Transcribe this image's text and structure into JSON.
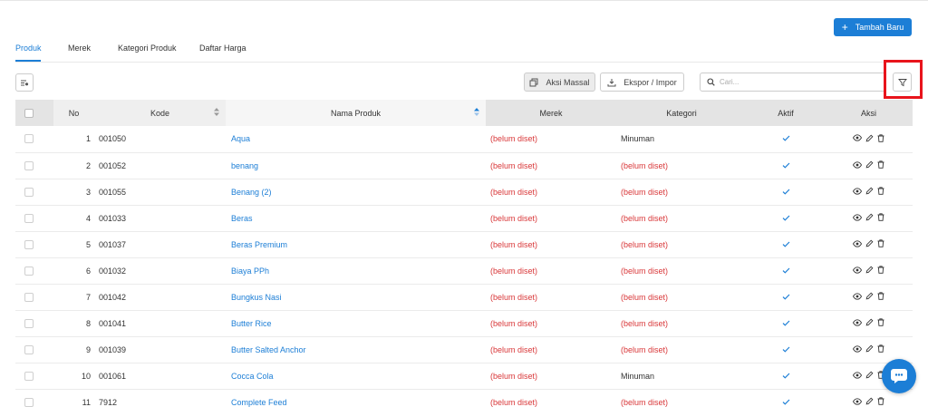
{
  "header": {
    "add_button_label": "Tambah Baru"
  },
  "tabs": [
    {
      "label": "Produk",
      "active": true
    },
    {
      "label": "Merek",
      "active": false
    },
    {
      "label": "Kategori Produk",
      "active": false
    },
    {
      "label": "Daftar Harga",
      "active": false
    }
  ],
  "toolbar": {
    "mass_action_label": "Aksi Massal",
    "export_import_label": "Ekspor / Impor",
    "search_placeholder": "Cari..."
  },
  "table": {
    "columns": [
      "No",
      "Kode",
      "Nama Produk",
      "Merek",
      "Kategori",
      "Aktif",
      "Aksi"
    ],
    "rows": [
      {
        "no": "1",
        "code": "001050",
        "name": "Aqua",
        "brand": "(belum diset)",
        "category": "Minuman"
      },
      {
        "no": "2",
        "code": "001052",
        "name": "benang",
        "brand": "(belum diset)",
        "category": "(belum diset)"
      },
      {
        "no": "3",
        "code": "001055",
        "name": "Benang (2)",
        "brand": "(belum diset)",
        "category": "(belum diset)"
      },
      {
        "no": "4",
        "code": "001033",
        "name": "Beras",
        "brand": "(belum diset)",
        "category": "(belum diset)"
      },
      {
        "no": "5",
        "code": "001037",
        "name": "Beras Premium",
        "brand": "(belum diset)",
        "category": "(belum diset)"
      },
      {
        "no": "6",
        "code": "001032",
        "name": "Biaya PPh",
        "brand": "(belum diset)",
        "category": "(belum diset)"
      },
      {
        "no": "7",
        "code": "001042",
        "name": "Bungkus Nasi",
        "brand": "(belum diset)",
        "category": "(belum diset)"
      },
      {
        "no": "8",
        "code": "001041",
        "name": "Butter Rice",
        "brand": "(belum diset)",
        "category": "(belum diset)"
      },
      {
        "no": "9",
        "code": "001039",
        "name": "Butter Salted Anchor",
        "brand": "(belum diset)",
        "category": "(belum diset)"
      },
      {
        "no": "10",
        "code": "001061",
        "name": "Cocca Cola",
        "brand": "(belum diset)",
        "category": "Minuman"
      },
      {
        "no": "11",
        "code": "7912",
        "name": "Complete Feed",
        "brand": "(belum diset)",
        "category": "(belum diset)"
      }
    ]
  },
  "colors": {
    "accent": "#1c7ed6",
    "unset": "#d9383a",
    "highlight": "#e8141c"
  },
  "icons": {
    "add": "plus-icon",
    "columns": "columns-toggle-icon",
    "mass": "copy-icon",
    "export": "download-icon",
    "search": "search-icon",
    "filter": "filter-icon",
    "view": "eye-icon",
    "edit": "pencil-icon",
    "delete": "trash-icon",
    "active": "check-icon",
    "chat": "chat-icon"
  }
}
